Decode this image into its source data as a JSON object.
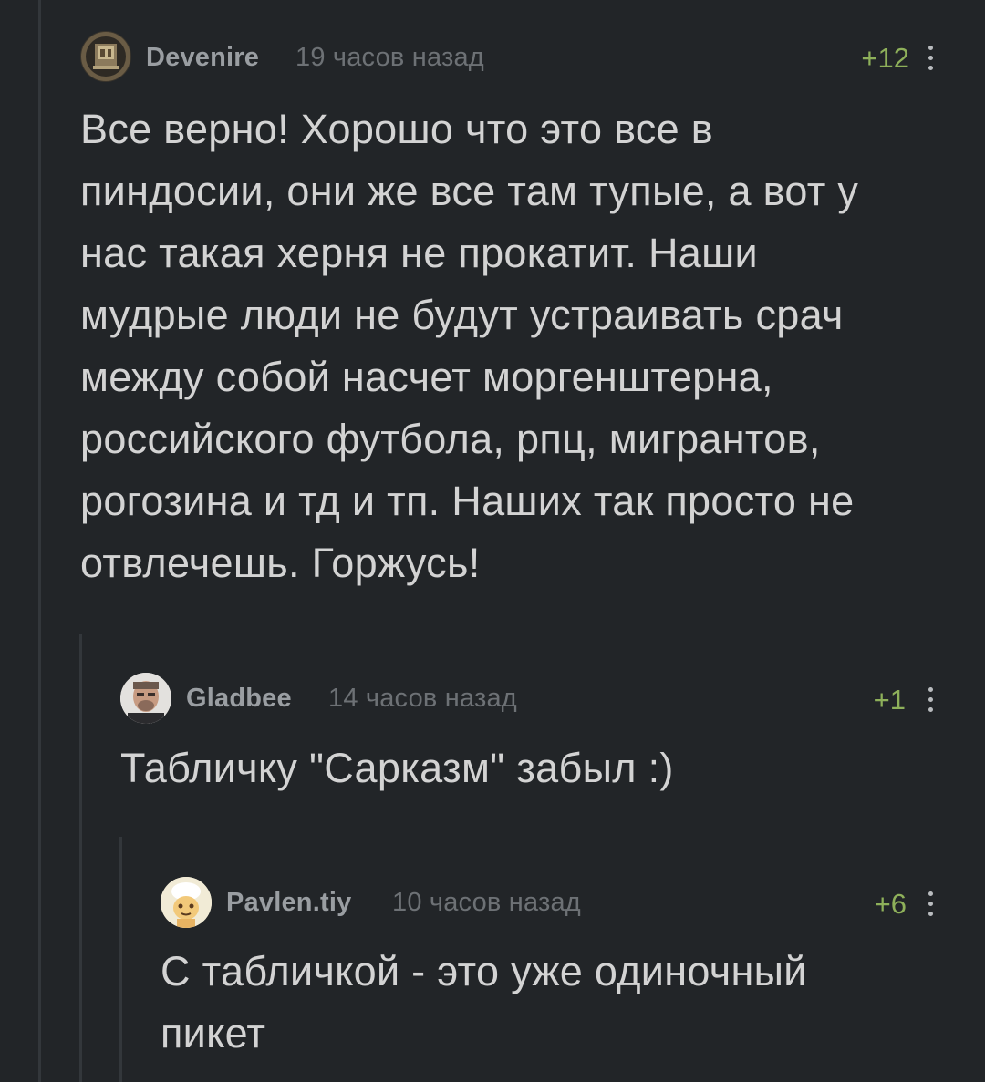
{
  "comments": [
    {
      "author": "Devenire",
      "time": "19 часов назад",
      "rating": "+12",
      "text": "Все верно! Хорошо что это все в пиндосии, они же все там тупые, а вот у нас такая херня не прокатит. Наши мудрые люди не будут устраивать срач между собой насчет моргенштерна, российского футбола, рпц, мигрантов, рогозина и тд и тп. Наших так просто не отвлечешь. Горжусь!",
      "text_lines": [
        "Все верно! Хорошо что это все в",
        "пиндосии, они же все там тупые, а вот у",
        "нас такая херня не прокатит. Наши",
        "мудрые люди не будут устраивать срач",
        "между собой насчет моргенштерна,",
        "российского футбола, рпц, мигрантов,",
        "рогозина и тд и тп. Наших так просто не",
        "отвлечешь. Горжусь!"
      ],
      "avatar_icon": "avatar-picture-icon"
    },
    {
      "author": "Gladbee",
      "time": "14 часов назад",
      "rating": "+1",
      "text_lines": [
        "Табличку \"Сарказм\" забыл :)"
      ],
      "avatar_icon": "avatar-photo-icon"
    },
    {
      "author": "Pavlen.tiy",
      "time": "10 часов назад",
      "rating": "+6",
      "text_lines": [
        "С табличкой - это уже одиночный",
        "пикет"
      ],
      "avatar_icon": "avatar-cartoon-icon"
    }
  ],
  "colors": {
    "background": "#222528",
    "rating_positive": "#8eb05a",
    "username": "#9a9ea2",
    "timestamp": "#6d7175",
    "text": "#d3d3d3"
  },
  "icons": {
    "more": "more-vertical-icon"
  }
}
